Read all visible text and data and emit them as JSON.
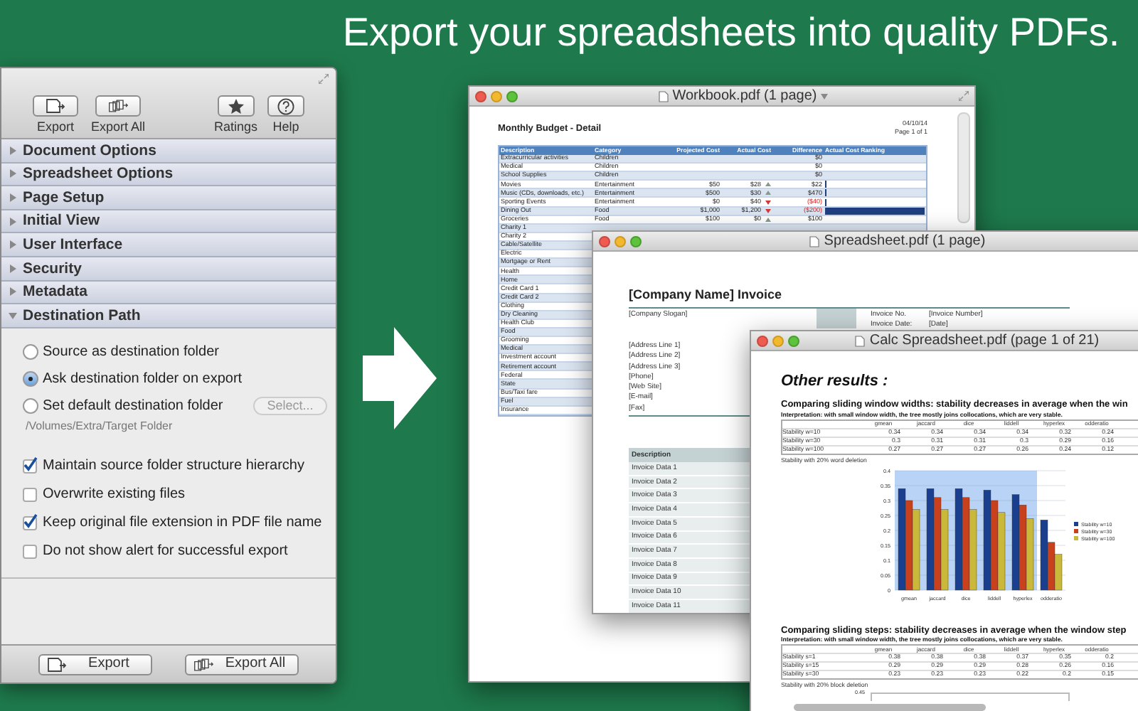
{
  "headline": "Export your spreadsheets into quality PDFs.",
  "panel": {
    "toolbar": [
      {
        "label": "Export",
        "kind": "export"
      },
      {
        "label": "Export All",
        "kind": "export-all"
      },
      {
        "label": "Ratings",
        "kind": "star"
      },
      {
        "label": "Help",
        "kind": "help"
      }
    ],
    "sections": [
      {
        "label": "Document Options",
        "expanded": false
      },
      {
        "label": "Spreadsheet Options",
        "expanded": false
      },
      {
        "label": "Page Setup",
        "expanded": false
      },
      {
        "label": "Initial View",
        "expanded": false
      },
      {
        "label": "User Interface",
        "expanded": false
      },
      {
        "label": "Security",
        "expanded": false
      },
      {
        "label": "Metadata",
        "expanded": false
      },
      {
        "label": "Destination Path",
        "expanded": true
      }
    ],
    "destination": {
      "radios": [
        {
          "label": "Source as destination folder",
          "selected": false
        },
        {
          "label": "Ask destination folder on export",
          "selected": true
        },
        {
          "label": "Set default destination folder",
          "selected": false
        }
      ],
      "select_button": {
        "label": "Select...",
        "disabled": true
      },
      "path": "/Volumes/Extra/Target Folder",
      "checkboxes": [
        {
          "label": "Maintain source folder structure hierarchy",
          "checked": true
        },
        {
          "label": "Overwrite existing files",
          "checked": false
        },
        {
          "label": "Keep original file extension in PDF file name",
          "checked": true
        },
        {
          "label": "Do not show alert for successful export",
          "checked": false
        }
      ]
    },
    "footer_buttons": [
      {
        "label": "Export",
        "kind": "export"
      },
      {
        "label": "Export All",
        "kind": "export-all"
      }
    ]
  },
  "workbook_window": {
    "title": "Workbook.pdf (1 page)",
    "doc_title": "Monthly Budget - Detail",
    "date": "04/10/14",
    "page": "Page 1 of 1",
    "columns": [
      "Description",
      "Category",
      "Projected Cost",
      "Actual Cost",
      "Difference",
      "Actual Cost Ranking"
    ],
    "rows": [
      {
        "description": "Extracurricular activities",
        "category": "Children",
        "difference": "$0"
      },
      {
        "description": "Medical",
        "category": "Children",
        "difference": "$0"
      },
      {
        "description": "School Supplies",
        "category": "Children",
        "difference": "$0"
      },
      {
        "description": "Movies",
        "category": "Entertainment",
        "projected": "$50",
        "actual": "$28",
        "trend_up": true,
        "difference": "$22",
        "negative": false,
        "level": 0.02
      },
      {
        "description": "Music (CDs, downloads, etc.)",
        "category": "Entertainment",
        "projected": "$500",
        "actual": "$30",
        "trend_up": true,
        "difference": "$470",
        "negative": false,
        "level": 0.02
      },
      {
        "description": "Sporting Events",
        "category": "Entertainment",
        "projected": "$0",
        "actual": "$40",
        "trend_up": false,
        "difference": "($40)",
        "negative": true,
        "level": 0.02
      },
      {
        "description": "Dining Out",
        "category": "Food",
        "projected": "$1,000",
        "actual": "$1,200",
        "trend_up": false,
        "difference": "($200)",
        "negative": true,
        "level": 1
      },
      {
        "description": "Groceries",
        "category": "Food",
        "projected": "$100",
        "actual": "$0",
        "trend_up": true,
        "difference": "$100",
        "negative": false
      },
      {
        "description": "Charity 1"
      },
      {
        "description": "Charity 2"
      },
      {
        "description": "Cable/Satellite"
      },
      {
        "description": "Electric"
      },
      {
        "description": "Mortgage or Rent"
      },
      {
        "description": "Health"
      },
      {
        "description": "Home"
      },
      {
        "description": "Credit Card 1"
      },
      {
        "description": "Credit Card 2"
      },
      {
        "description": "Clothing"
      },
      {
        "description": "Dry Cleaning"
      },
      {
        "description": "Health Club"
      },
      {
        "description": "Food"
      },
      {
        "description": "Grooming"
      },
      {
        "description": "Medical"
      },
      {
        "description": "Investment account"
      },
      {
        "description": "Retirement account"
      },
      {
        "description": "Federal"
      },
      {
        "description": "State"
      },
      {
        "description": "Bus/Taxi fare"
      },
      {
        "description": "Fuel"
      },
      {
        "description": "Insurance"
      }
    ]
  },
  "spreadsheet_window": {
    "title": "Spreadsheet.pdf (1 page)",
    "doc_title": "[Company Name] Invoice",
    "slogan": "[Company Slogan]",
    "fields": [
      {
        "label": "Invoice No.",
        "value": "[Invoice Number]"
      },
      {
        "label": "Invoice Date:",
        "value": "[Date]"
      }
    ],
    "address": [
      "[Address Line 1]",
      "[Address Line 2]",
      "[Address Line 3]",
      "[Phone]",
      "[Web Site]",
      "[E-mail]",
      "[Fax]"
    ],
    "table_header": "Description",
    "rows": [
      "Invoice Data 1",
      "Invoice Data 2",
      "Invoice Data 3",
      "Invoice Data 4",
      "Invoice Data 5",
      "Invoice Data 6",
      "Invoice Data 7",
      "Invoice Data 8",
      "Invoice Data 9",
      "Invoice Data 10",
      "Invoice Data 11"
    ]
  },
  "calc_window": {
    "title": "Calc Spreadsheet.pdf (page 1 of 21)",
    "doc_title": "Other results :",
    "sections": [
      {
        "heading": "Comparing sliding window widths: stability decreases in average when the win",
        "note": "Interpretation: with small window width, the tree mostly joins collocations, which are very stable.",
        "columns": [
          "gmean",
          "jaccard",
          "dice",
          "liddell",
          "hyperlex",
          "odderatio"
        ],
        "rows": [
          {
            "label": "Stability w=10",
            "values": [
              "0.34",
              "0.34",
              "0.34",
              "0.34",
              "0.32",
              "0.24"
            ]
          },
          {
            "label": "Stability w=30",
            "values": [
              "0.3",
              "0.31",
              "0.31",
              "0.3",
              "0.29",
              "0.16"
            ]
          },
          {
            "label": "Stability w=100",
            "values": [
              "0.27",
              "0.27",
              "0.27",
              "0.26",
              "0.24",
              "0.12"
            ]
          }
        ],
        "caption": "Stability with 20% word deletion",
        "chart_data": {
          "type": "bar",
          "categories": [
            "gmean",
            "jaccard",
            "dice",
            "liddell",
            "hyperlex",
            "odderatio"
          ],
          "series": [
            {
              "name": "Stability w=10",
              "color": "#1b3f8f",
              "values": [
                0.34,
                0.34,
                0.34,
                0.335,
                0.32,
                0.235
              ]
            },
            {
              "name": "Stability w=30",
              "color": "#c8401c",
              "values": [
                0.3,
                0.31,
                0.31,
                0.3,
                0.285,
                0.16
              ]
            },
            {
              "name": "Stability w=100",
              "color": "#c9b83a",
              "values": [
                0.27,
                0.27,
                0.27,
                0.26,
                0.24,
                0.12
              ]
            }
          ],
          "grid": true,
          "legend": true,
          "bands": [
            {
              "axis": "x",
              "from": "gmean",
              "to": "hyperlex",
              "color": "#b9d3f6"
            }
          ],
          "ylim": [
            0,
            0.4
          ],
          "yticks": [
            {
              "value": 0,
              "label": "0"
            },
            {
              "value": 0.05,
              "label": "0.05"
            },
            {
              "value": 0.1,
              "label": "0.1"
            },
            {
              "value": 0.15,
              "label": "0.15"
            },
            {
              "value": 0.2,
              "label": "0.2"
            },
            {
              "value": 0.25,
              "label": "0.25"
            },
            {
              "value": 0.3,
              "label": "0.3"
            },
            {
              "value": 0.35,
              "label": "0.35"
            },
            {
              "value": 0.4,
              "label": "0.4"
            }
          ]
        }
      },
      {
        "heading": "Comparing sliding steps: stability decreases in average when the window step",
        "note": "Interpretation: with small window width, the tree mostly joins collocations, which are very stable.",
        "columns": [
          "gmean",
          "jaccard",
          "dice",
          "liddell",
          "hyperlex",
          "odderatio"
        ],
        "rows": [
          {
            "label": "Stability s=1",
            "values": [
              "0.38",
              "0.38",
              "0.38",
              "0.37",
              "0.35",
              "0.2"
            ]
          },
          {
            "label": "Stability s=15",
            "values": [
              "0.29",
              "0.29",
              "0.29",
              "0.28",
              "0.26",
              "0.16"
            ]
          },
          {
            "label": "Stability s=30",
            "values": [
              "0.23",
              "0.23",
              "0.23",
              "0.22",
              "0.2",
              "0.15"
            ]
          }
        ],
        "caption": "Stability with 20% block deletion",
        "chart_top_tick": "0.45"
      }
    ]
  }
}
